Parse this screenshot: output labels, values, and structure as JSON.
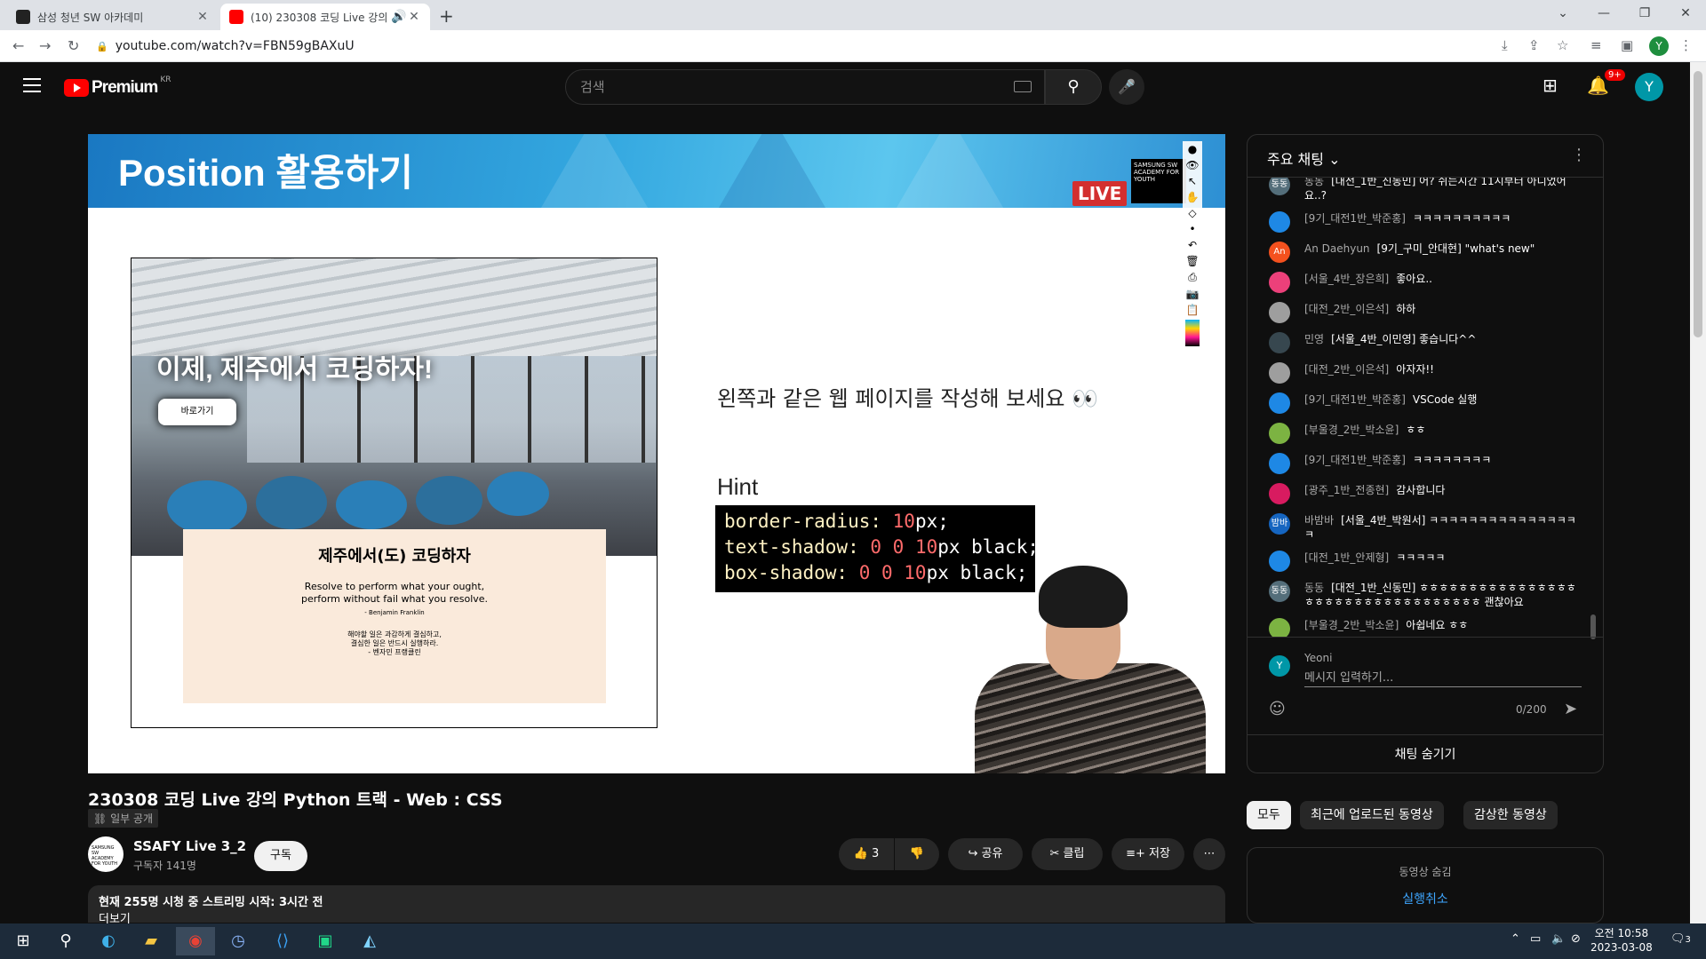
{
  "browser": {
    "tabs": [
      {
        "title": "삼성 청년 SW 아카데미",
        "active": false
      },
      {
        "title": "(10) 230308 코딩 Live 강의",
        "active": true
      }
    ],
    "url": "youtube.com/watch?v=FBN59gBAXuU",
    "profile_initial": "Y"
  },
  "youtube": {
    "logo_text": "Premium",
    "region": "KR",
    "search_placeholder": "검색",
    "notif_count": "9+",
    "avatar_initial": "Y"
  },
  "slide": {
    "title": "Position 활용하기",
    "live": "LIVE",
    "ssafy_box": "SAMSUNG SW ACADEMY FOR YOUTH",
    "web_headline": "이제, 제주에서 코딩하자!",
    "web_button": "바로가기",
    "card_title": "제주에서(도) 코딩하자",
    "card_quote": "Resolve to perform what your ought,\nperform without fail what you resolve.",
    "card_author": "- Benjamin Franklin",
    "card_kr": "해야할 일은 과감하게 결심하고,\n결심한 일은 반드시 실행하라.\n- 벤자민 프랭클린",
    "instruction": "왼쪽과 같은 웹 페이지를 작성해 보세요 👀",
    "hint_label": "Hint",
    "code": [
      {
        "prop": "border-radius: ",
        "num": "10",
        "rest": "px;"
      },
      {
        "prop": "text-shadow: ",
        "num": "0 0 10",
        "rest": "px black;"
      },
      {
        "prop": "box-shadow: ",
        "num": "0 0 10",
        "rest": "px black;"
      }
    ]
  },
  "chat": {
    "header": "주요 채팅",
    "messages": [
      {
        "avatar": "동동",
        "color": "#546e7a",
        "author": "동동",
        "text": "[대전_1반_신동민] 어? 쉬는시간 11시부터 아니었어요..?"
      },
      {
        "avatar": "",
        "color": "#1e88e5",
        "author": "[9기_대전1반_박준홍]",
        "text": "ㅋㅋㅋㅋㅋㅋㅋㅋㅋㅋ"
      },
      {
        "avatar": "An",
        "color": "#f4511e",
        "author": "An Daehyun",
        "text": "[9기_구미_안대현] \"what's new\""
      },
      {
        "avatar": "",
        "color": "#ec407a",
        "author": "[서울_4반_장은희]",
        "text": "좋아요.."
      },
      {
        "avatar": "",
        "color": "#9e9e9e",
        "author": "[대전_2반_이은석]",
        "text": "하하"
      },
      {
        "avatar": "",
        "color": "#37474f",
        "author": "민영",
        "text": "[서울_4반_이민영] 좋습니다^^"
      },
      {
        "avatar": "",
        "color": "#9e9e9e",
        "author": "[대전_2반_이은석]",
        "text": "아자자!!"
      },
      {
        "avatar": "",
        "color": "#1e88e5",
        "author": "[9기_대전1반_박준홍]",
        "text": "VSCode 실행"
      },
      {
        "avatar": "",
        "color": "#7cb342",
        "author": "[부울경_2반_박소윤]",
        "text": "ㅎㅎ"
      },
      {
        "avatar": "",
        "color": "#1e88e5",
        "author": "[9기_대전1반_박준홍]",
        "text": "ㅋㅋㅋㅋㅋㅋㅋㅋ"
      },
      {
        "avatar": "",
        "color": "#d81b60",
        "author": "[광주_1반_전종현]",
        "text": "감사합니다"
      },
      {
        "avatar": "밤바",
        "color": "#1565c0",
        "author": "바밤바",
        "text": "[서울_4반_박원서] ㅋㅋㅋㅋㅋㅋㅋㅋㅋㅋㅋㅋㅋㅋㅋㅋ"
      },
      {
        "avatar": "",
        "color": "#1e88e5",
        "author": "[대전_1반_안제형]",
        "text": "ㅋㅋㅋㅋㅋ"
      },
      {
        "avatar": "동동",
        "color": "#546e7a",
        "author": "동동",
        "text": "[대전_1반_신동민] ㅎㅎㅎㅎㅎㅎㅎㅎㅎㅎㅎㅎㅎㅎㅎㅎㅎㅎㅎㅎㅎㅎㅎㅎㅎㅎㅎㅎㅎㅎㅎㅎㅎㅎ 괜찮아요"
      },
      {
        "avatar": "",
        "color": "#7cb342",
        "author": "[부울경_2반_박소윤]",
        "text": "아쉽네요 ㅎㅎ"
      }
    ],
    "input_name": "Yeoni",
    "input_placeholder": "메시지 입력하기...",
    "input_avatar": "Y",
    "counter": "0/200",
    "hide_label": "채팅 숨기기"
  },
  "video": {
    "title": "230308 코딩 Live 강의 Python 트랙 - Web : CSS",
    "visibility": "일부 공개",
    "channel": "SSAFY Live 3_2",
    "subscribers": "구독자 141명",
    "subscribe": "구독",
    "likes": "3",
    "share": "공유",
    "clip": "클립",
    "save": "저장",
    "desc_line1": "현재 255명 시청 중 스트리밍 시작: 3시간 전",
    "desc_line2": "더보기"
  },
  "side": {
    "chips": [
      "모두",
      "최근에 업로드된 동영상",
      "감상한 동영상"
    ],
    "hidden_title": "동영상 숨김",
    "undo": "실행취소"
  },
  "taskbar": {
    "time": "오전 10:58",
    "date": "2023-03-08",
    "notif": "3"
  }
}
